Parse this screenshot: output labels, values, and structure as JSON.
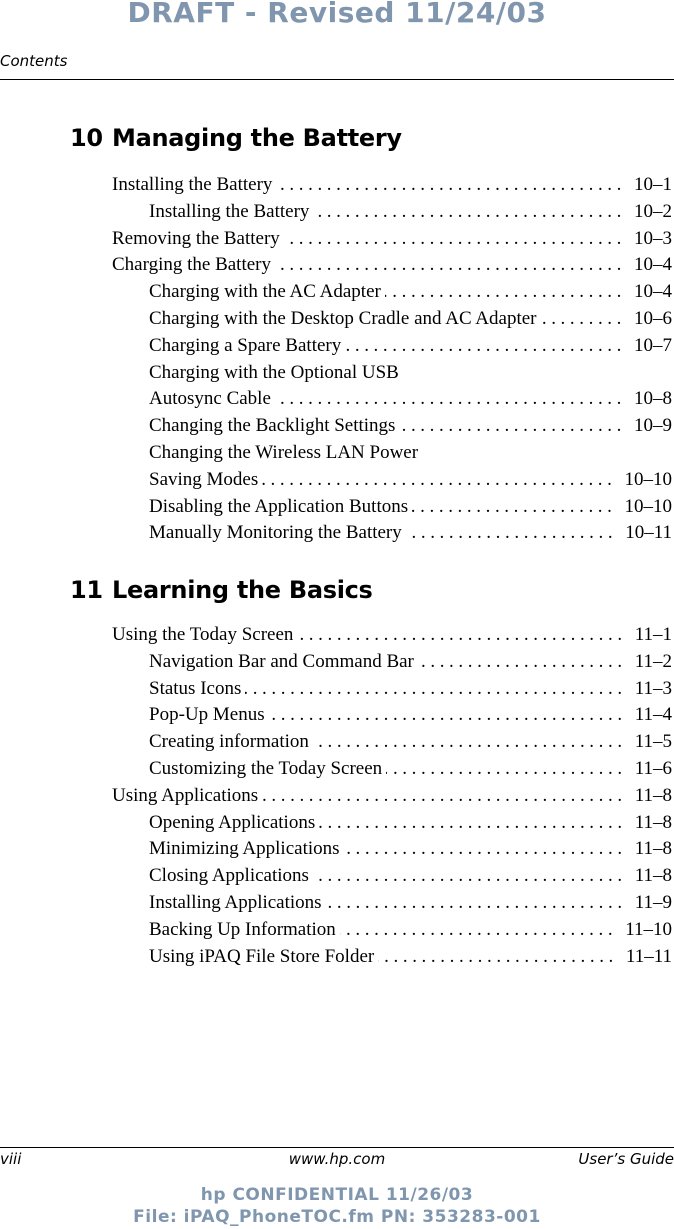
{
  "watermark": {
    "top": "DRAFT - Revised 11/24/03",
    "confidential_line1": "hp CONFIDENTIAL 11/26/03",
    "confidential_line2": "File: iPAQ_PhoneTOC.fm PN: 353283-001",
    "color": "#7f96ae"
  },
  "header": {
    "running_head": "Contents"
  },
  "chapters": [
    {
      "number": "10",
      "title": "Managing the Battery",
      "entries": [
        {
          "level": 1,
          "title": "Installing the Battery",
          "page": "10–1"
        },
        {
          "level": 2,
          "title": "Installing the Battery",
          "page": "10–2"
        },
        {
          "level": 1,
          "title": "Removing the Battery",
          "page": "10–3"
        },
        {
          "level": 1,
          "title": "Charging the Battery",
          "page": "10–4"
        },
        {
          "level": 2,
          "title": "Charging with the AC Adapter",
          "page": "10–4"
        },
        {
          "level": 2,
          "title": "Charging with the Desktop Cradle and AC Adapter",
          "page": "10–6"
        },
        {
          "level": 2,
          "title": "Charging a Spare Battery",
          "page": "10–7"
        },
        {
          "level": 2,
          "title": "Charging with the Optional USB",
          "page": ""
        },
        {
          "level": 2,
          "title": "Autosync Cable",
          "page": "10–8"
        },
        {
          "level": 2,
          "title": "Changing the Backlight Settings",
          "page": "10–9"
        },
        {
          "level": 2,
          "title": "Changing the Wireless LAN Power",
          "page": ""
        },
        {
          "level": 2,
          "title": "Saving Modes",
          "page": "10–10"
        },
        {
          "level": 2,
          "title": "Disabling the Application Buttons",
          "page": "10–10"
        },
        {
          "level": 2,
          "title": "Manually Monitoring the Battery",
          "page": "10–11"
        }
      ]
    },
    {
      "number": "11",
      "title": "Learning the Basics",
      "entries": [
        {
          "level": 1,
          "title": "Using the Today Screen",
          "page": "11–1"
        },
        {
          "level": 2,
          "title": "Navigation Bar and Command Bar",
          "page": "11–2"
        },
        {
          "level": 2,
          "title": "Status Icons",
          "page": "11–3"
        },
        {
          "level": 2,
          "title": "Pop-Up Menus",
          "page": "11–4"
        },
        {
          "level": 2,
          "title": "Creating information",
          "page": "11–5"
        },
        {
          "level": 2,
          "title": "Customizing the Today Screen",
          "page": "11–6"
        },
        {
          "level": 1,
          "title": "Using Applications",
          "page": "11–8"
        },
        {
          "level": 2,
          "title": "Opening Applications",
          "page": "11–8"
        },
        {
          "level": 2,
          "title": "Minimizing Applications",
          "page": "11–8"
        },
        {
          "level": 2,
          "title": "Closing Applications",
          "page": "11–8"
        },
        {
          "level": 2,
          "title": "Installing Applications",
          "page": "11–9"
        },
        {
          "level": 2,
          "title": "Backing Up Information",
          "page": "11–10"
        },
        {
          "level": 2,
          "title": "Using iPAQ File Store Folder",
          "page": "11–11"
        }
      ]
    }
  ],
  "footer": {
    "page_number": "viii",
    "url": "www.hp.com",
    "doc_title": "User’s Guide"
  }
}
